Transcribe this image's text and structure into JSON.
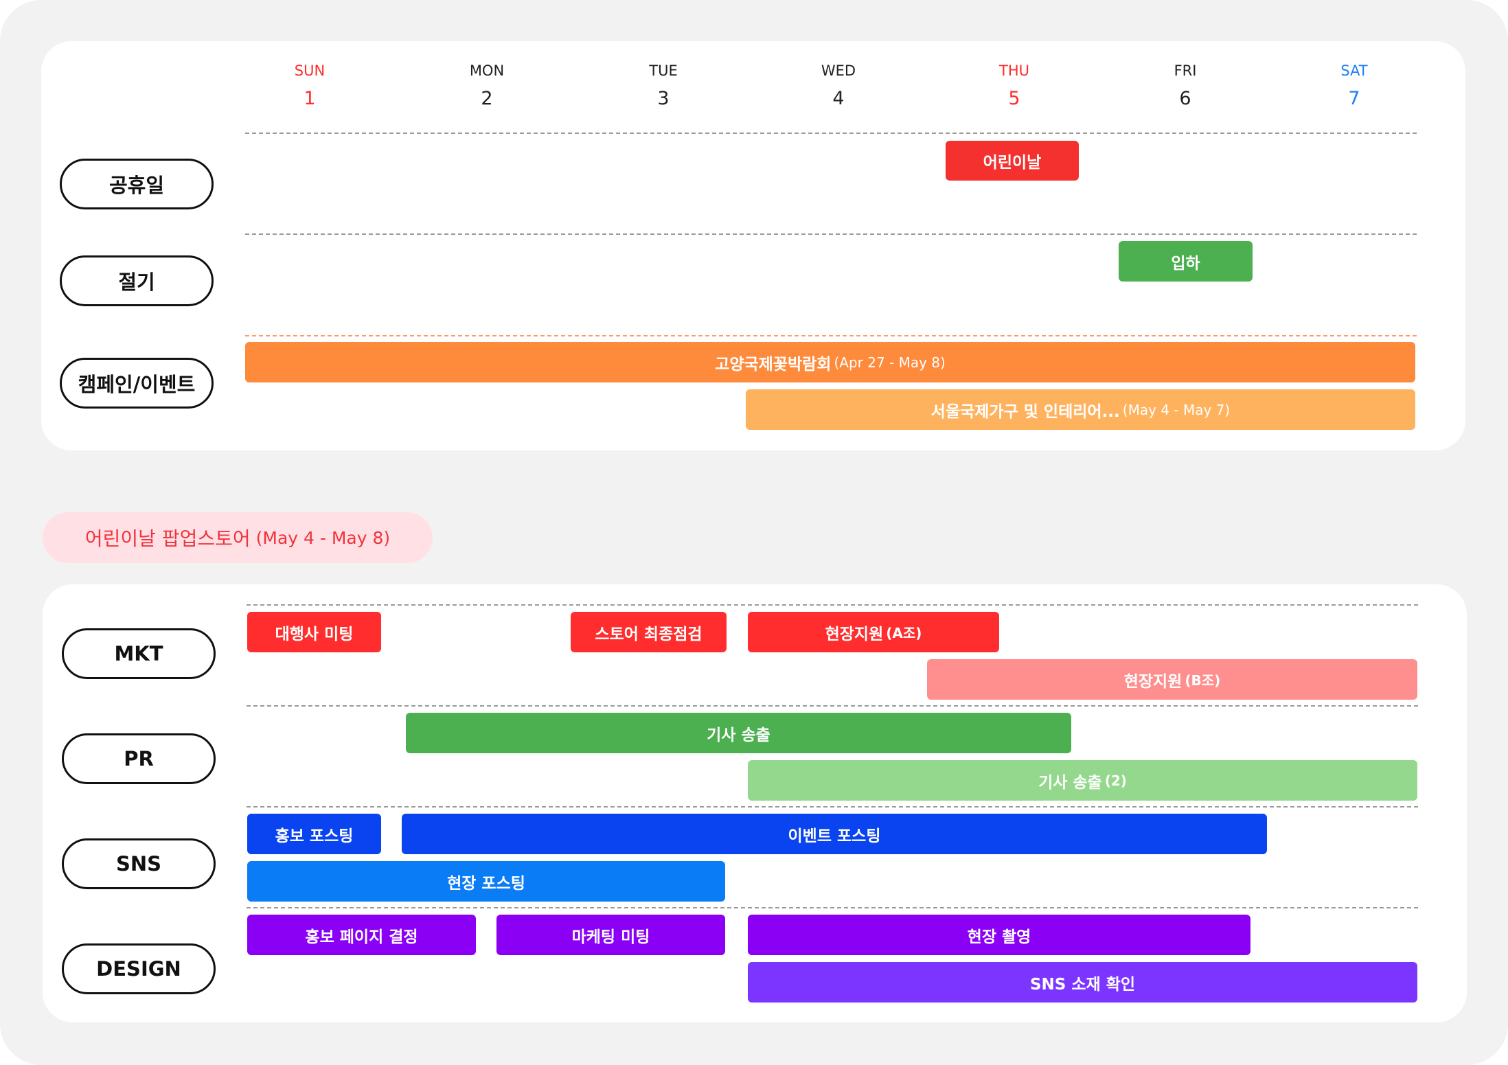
{
  "calendar": {
    "days": [
      {
        "name": "SUN",
        "num": "1"
      },
      {
        "name": "MON",
        "num": "2"
      },
      {
        "name": "TUE",
        "num": "3"
      },
      {
        "name": "WED",
        "num": "4"
      },
      {
        "name": "THU",
        "num": "5"
      },
      {
        "name": "FRI",
        "num": "6"
      },
      {
        "name": "SAT",
        "num": "7"
      }
    ],
    "colors": {
      "holiday_red": "#ff2d2d",
      "saturday_blue": "#1e7ff0"
    }
  },
  "top_panel": {
    "rows": [
      {
        "label": "공휴일"
      },
      {
        "label": "절기"
      },
      {
        "label": "캠페인/이벤트"
      }
    ],
    "events": {
      "holiday": {
        "title": "어린이날",
        "color": "#f5312f"
      },
      "solar_term": {
        "title": "입하",
        "color": "#4caf50"
      },
      "campaign1": {
        "title": "고양국제꽃박람회",
        "dates": "(Apr 27 - May 8)",
        "color": "#fe8a3c"
      },
      "campaign2": {
        "title": "서울국제가구 및 인테리어...",
        "dates": "(May 4 - May 7)",
        "color": "#ffb25e"
      }
    }
  },
  "popup": {
    "title": "어린이날 팝업스토어",
    "dates": "(May 4 - May 8)"
  },
  "bottom_panel": {
    "rows": [
      {
        "label": "MKT"
      },
      {
        "label": "PR"
      },
      {
        "label": "SNS"
      },
      {
        "label": "DESIGN"
      }
    ],
    "tasks": {
      "mkt_agency_meeting": {
        "title": "대행사 미팅",
        "color": "#ff2d2d"
      },
      "mkt_store_check": {
        "title": "스토어 최종점검",
        "color": "#ff2d2d"
      },
      "mkt_onsite_a": {
        "title": "현장지원",
        "suffix": "(A조)",
        "color": "#ff2d2d"
      },
      "mkt_onsite_b": {
        "title": "현장지원",
        "suffix": "(B조)",
        "color": "#ff8e8e"
      },
      "pr_article": {
        "title": "기사 송출",
        "color": "#4caf50"
      },
      "pr_article2": {
        "title": "기사 송출",
        "suffix": "(2)",
        "color": "#93d88c"
      },
      "sns_promo_post": {
        "title": "홍보 포스팅",
        "color": "#0a44f0"
      },
      "sns_event_post": {
        "title": "이벤트 포스팅",
        "color": "#0a44f0"
      },
      "sns_onsite_post": {
        "title": "현장 포스팅",
        "color": "#0a7cf5"
      },
      "design_promo_page": {
        "title": "홍보 페이지 결정",
        "color": "#8b00f5"
      },
      "design_marketing_meeting": {
        "title": "마케팅 미팅",
        "color": "#8b00f5"
      },
      "design_onsite_shoot": {
        "title": "현장 촬영",
        "color": "#8b00f5"
      },
      "design_sns_material": {
        "title": "SNS 소재 확인",
        "color": "#7c35ff"
      }
    }
  }
}
